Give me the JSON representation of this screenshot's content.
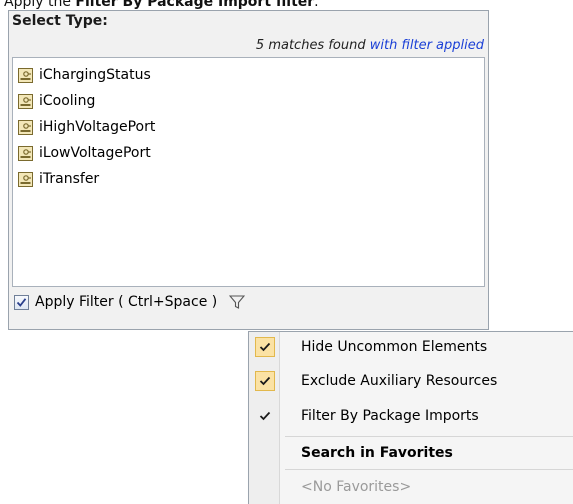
{
  "caption": {
    "prefix": "Apply the ",
    "bold": "Filter By Package Import filter",
    "suffix": "."
  },
  "dialog": {
    "title": "Select Type:",
    "matches_text": "5 matches found",
    "filter_applied_text": "with filter applied",
    "items": [
      {
        "label": "iChargingStatus",
        "icon": "interface-icon"
      },
      {
        "label": "iCooling",
        "icon": "interface-icon"
      },
      {
        "label": "iHighVoltagePort",
        "icon": "interface-icon"
      },
      {
        "label": "iLowVoltagePort",
        "icon": "interface-icon"
      },
      {
        "label": "iTransfer",
        "icon": "interface-icon"
      }
    ],
    "apply_filter": {
      "label": "Apply Filter ( Ctrl+Space )",
      "checked": true
    }
  },
  "menu": {
    "items": [
      {
        "label": "Hide Uncommon Elements",
        "checked": true
      },
      {
        "label": "Exclude Auxiliary Resources",
        "checked": true
      },
      {
        "label": "Filter By Package Imports",
        "checked": true,
        "highlighted": true
      },
      {
        "label": "Search in Favorites",
        "bold": true
      },
      {
        "label": "<No Favorites>",
        "disabled": true
      }
    ]
  },
  "colors": {
    "highlight_border": "#f08a1c",
    "link_blue": "#1a3fd6",
    "check_bg": "#fbe2a4"
  }
}
